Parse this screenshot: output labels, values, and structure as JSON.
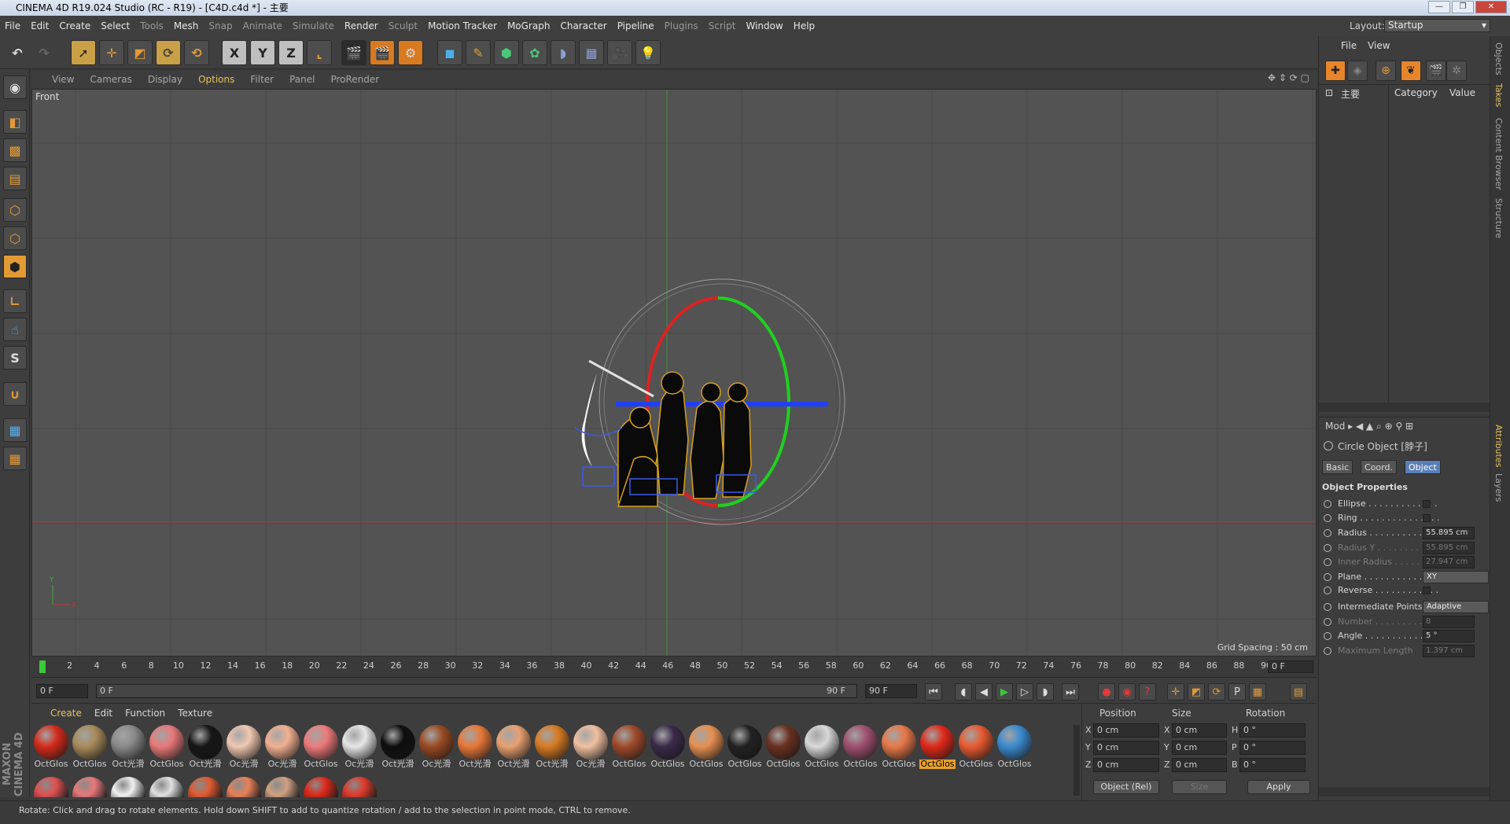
{
  "window": {
    "title": "CINEMA 4D R19.024 Studio (RC - R19) - [C4D.c4d *] - 主要"
  },
  "menubar": {
    "items": [
      "File",
      "Edit",
      "Create",
      "Select",
      "Tools",
      "Mesh",
      "Snap",
      "Animate",
      "Simulate",
      "Render",
      "Sculpt",
      "Motion Tracker",
      "MoGraph",
      "Character",
      "Pipeline",
      "Plugins",
      "Script",
      "Window",
      "Help"
    ]
  },
  "layout": {
    "label": "Layout:",
    "value": "Startup"
  },
  "viewport": {
    "menu": [
      "View",
      "Cameras",
      "Display",
      "Options",
      "Filter",
      "Panel",
      "ProRender"
    ],
    "active_menu": "Options",
    "label": "Front",
    "grid_spacing": "Grid Spacing : 50 cm",
    "axis_y": "Y",
    "axis_x": "X"
  },
  "timeline": {
    "ticks": [
      "0",
      "2",
      "4",
      "6",
      "8",
      "10",
      "12",
      "14",
      "16",
      "18",
      "20",
      "22",
      "24",
      "26",
      "28",
      "30",
      "32",
      "34",
      "36",
      "38",
      "40",
      "42",
      "44",
      "46",
      "48",
      "50",
      "52",
      "54",
      "56",
      "58",
      "60",
      "62",
      "64",
      "66",
      "68",
      "70",
      "72",
      "74",
      "76",
      "78",
      "80",
      "82",
      "84",
      "86",
      "88",
      "90"
    ],
    "end_field": "0 F"
  },
  "transport": {
    "start": "0 F",
    "range_start": "0 F",
    "range_end": "90 F",
    "end": "90 F"
  },
  "materials": {
    "menu": [
      "Create",
      "Edit",
      "Function",
      "Texture"
    ],
    "row1": [
      {
        "label": "OctGlos",
        "color": "#d42a1a"
      },
      {
        "label": "OctGlos",
        "color": "#a88a5a"
      },
      {
        "label": "Oct光滑",
        "color": "#8a8a8a"
      },
      {
        "label": "OctGlos",
        "color": "#e87878"
      },
      {
        "label": "Oct光滑",
        "color": "#161616"
      },
      {
        "label": "Oc光滑",
        "color": "#f0c8b0"
      },
      {
        "label": "Oc光滑",
        "color": "#f2b090"
      },
      {
        "label": "OctGlos",
        "color": "#ee7a7a"
      },
      {
        "label": "Oc光滑",
        "color": "#e6e6e6"
      },
      {
        "label": "Oct光滑",
        "color": "#0e0e0e"
      },
      {
        "label": "Oc光滑",
        "color": "#9a4a22"
      },
      {
        "label": "Oct光滑",
        "color": "#e87838"
      },
      {
        "label": "Oct光滑",
        "color": "#e8a070"
      },
      {
        "label": "Oct光滑",
        "color": "#d87a22"
      },
      {
        "label": "Oc光滑",
        "color": "#f0c0a0"
      },
      {
        "label": "OctGlos",
        "color": "#a04a2a"
      },
      {
        "label": "OctGlos",
        "color": "#3a2a4a"
      },
      {
        "label": "OctGlos",
        "color": "#e89050"
      },
      {
        "label": "OctGlos",
        "color": "#222222"
      },
      {
        "label": "OctGlos",
        "color": "#6a3020"
      },
      {
        "label": "OctGlos",
        "color": "#d8d8d8"
      },
      {
        "label": "OctGlos",
        "color": "#a05070"
      },
      {
        "label": "OctGlos",
        "color": "#e87848"
      },
      {
        "label": "OctGlos",
        "color": "#e02818"
      },
      {
        "label": "OctGlos",
        "color": "#e85a30"
      },
      {
        "label": "OctGlos",
        "color": "#3a8ad0"
      }
    ],
    "row2": [
      "#e05050",
      "#e87878",
      "#f0f0f0",
      "#e0e0e0",
      "#e05a30",
      "#e88058",
      "#d0a080",
      "#e02818",
      "#e03a2a"
    ],
    "selected_index": 23
  },
  "coords": {
    "headers": [
      "Position",
      "Size",
      "Rotation"
    ],
    "rows": [
      {
        "axis": "X",
        "pos": "0 cm",
        "saxis": "X",
        "size": "0 cm",
        "raxis": "H",
        "rot": "0 °"
      },
      {
        "axis": "Y",
        "pos": "0 cm",
        "saxis": "Y",
        "size": "0 cm",
        "raxis": "P",
        "rot": "0 °"
      },
      {
        "axis": "Z",
        "pos": "0 cm",
        "saxis": "Z",
        "size": "0 cm",
        "raxis": "B",
        "rot": "0 °"
      }
    ],
    "mode": "Object (Rel)",
    "size_mode": "Size",
    "apply": "Apply"
  },
  "objects": {
    "menu": [
      "File",
      "View"
    ],
    "tree_item": "主要",
    "columns": [
      "Category",
      "Value"
    ]
  },
  "attributes": {
    "mode": "Mod",
    "object": "Circle Object [脖子]",
    "tabs": [
      "Basic",
      "Coord.",
      "Object"
    ],
    "active_tab": "Object",
    "section": "Object Properties",
    "props": [
      {
        "name": "Ellipse . . . . . . . . . . . . .",
        "type": "check",
        "enabled": true
      },
      {
        "name": "Ring . . . . . . . . . . . . . . .",
        "type": "check",
        "enabled": true
      },
      {
        "name": "Radius . . . . . . . . . . . . .",
        "type": "value",
        "value": "55.895 cm",
        "enabled": true
      },
      {
        "name": "Radius Y . . . . . . . . . . .",
        "type": "value",
        "value": "55.895 cm",
        "enabled": false
      },
      {
        "name": "Inner Radius . . . . . . . .",
        "type": "value",
        "value": "27.947 cm",
        "enabled": false
      },
      {
        "name": "Plane . . . . . . . . . . . . . .",
        "type": "select",
        "value": "XY",
        "enabled": true
      },
      {
        "name": "Reverse . . . . . . . . . . . .",
        "type": "check",
        "enabled": true
      },
      {
        "name": "Intermediate Points",
        "type": "select",
        "value": "Adaptive",
        "enabled": true
      },
      {
        "name": "Number . . . . . . . . . . . .",
        "type": "value",
        "value": "8",
        "enabled": false
      },
      {
        "name": "Angle . . . . . . . . . . . . . .",
        "type": "value",
        "value": "5 °",
        "enabled": true
      },
      {
        "name": "Maximum Length",
        "type": "value",
        "value": "1.397 cm",
        "enabled": false
      }
    ]
  },
  "sidetabs": [
    "Objects",
    "Takes",
    "Content Browser",
    "Structure",
    "Attributes",
    "Layers"
  ],
  "status": {
    "text": "Rotate: Click and drag to rotate elements. Hold down SHIFT to add to quantize rotation / add to the selection in point mode, CTRL to remove."
  },
  "brand": {
    "text": "MAXON CINEMA 4D"
  },
  "colors": {
    "accent": "#e8a02a",
    "viewport_bg": "#535353",
    "active_menu": "#e8c35a"
  }
}
